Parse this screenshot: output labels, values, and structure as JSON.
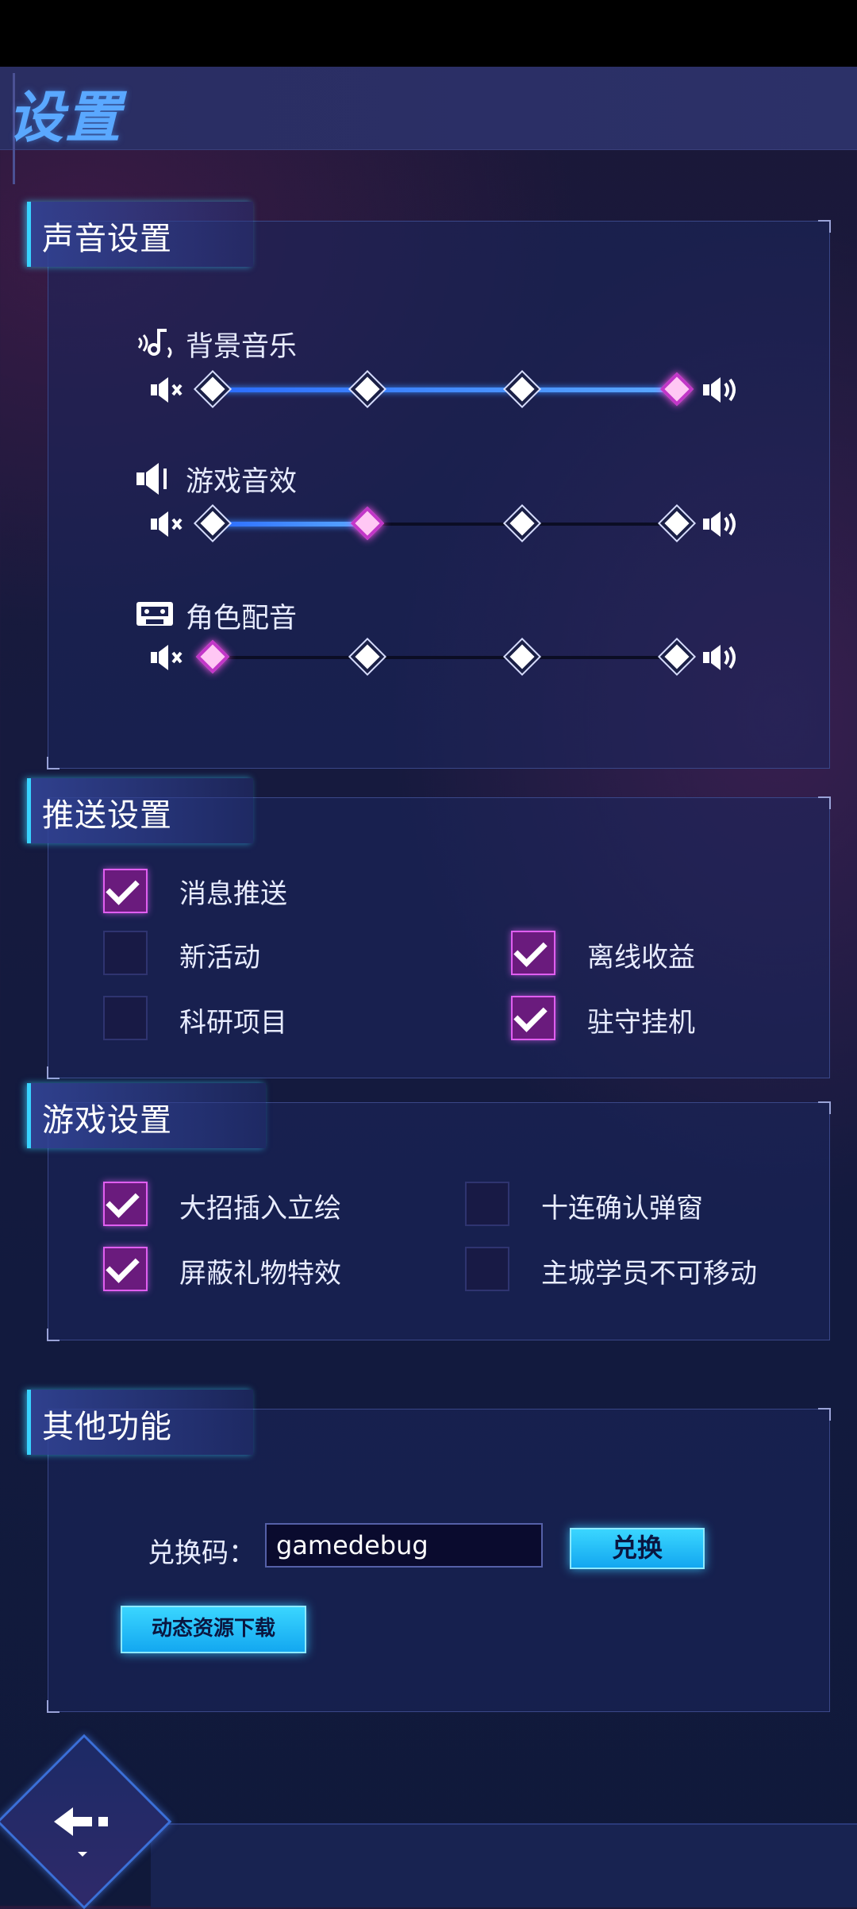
{
  "page": {
    "title": "设置"
  },
  "sound": {
    "heading": "声音设置",
    "sliders": [
      {
        "label": "背景音乐",
        "icon": "music-note-icon",
        "level": 3,
        "max": 3
      },
      {
        "label": "游戏音效",
        "icon": "speaker-icon",
        "level": 1,
        "max": 3
      },
      {
        "label": "角色配音",
        "icon": "cassette-icon",
        "level": 0,
        "max": 3
      }
    ],
    "mute_icon": "volume-mute-icon",
    "max_icon": "volume-max-icon"
  },
  "push": {
    "heading": "推送设置",
    "options": [
      {
        "label": "消息推送",
        "checked": true
      },
      {
        "label": "新活动",
        "checked": false
      },
      {
        "label": "离线收益",
        "checked": true
      },
      {
        "label": "科研项目",
        "checked": false
      },
      {
        "label": "驻守挂机",
        "checked": true
      }
    ]
  },
  "game": {
    "heading": "游戏设置",
    "options": [
      {
        "label": "大招插入立绘",
        "checked": true
      },
      {
        "label": "十连确认弹窗",
        "checked": false
      },
      {
        "label": "屏蔽礼物特效",
        "checked": true
      },
      {
        "label": "主城学员不可移动",
        "checked": false
      }
    ]
  },
  "other": {
    "heading": "其他功能",
    "redeem_label": "兑换码：",
    "redeem_value": "gamedebug",
    "redeem_button": "兑换",
    "download_button": "动态资源下载"
  },
  "colors": {
    "accent": "#38d3ff",
    "knob_active": "#ff59ee",
    "check_on": "#6a1b7d"
  },
  "back_icon": "back-arrow-icon"
}
